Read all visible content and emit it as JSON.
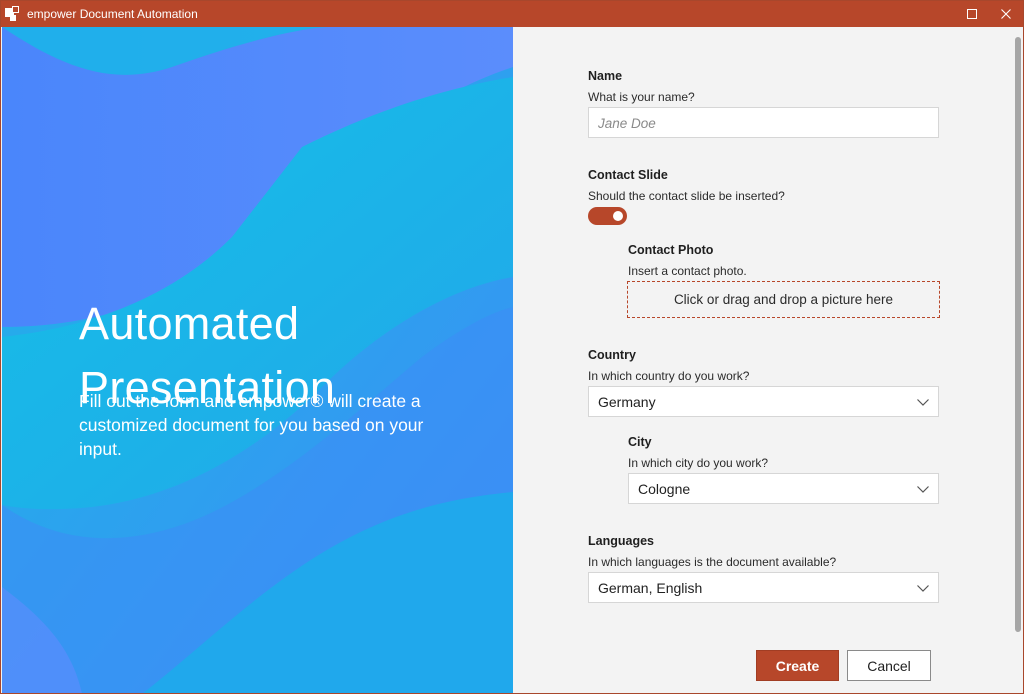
{
  "window": {
    "title": "empower Document Automation",
    "accent_color": "#b7472a"
  },
  "hero": {
    "title_line1": "Automated",
    "title_line2": "Presentation",
    "description": "Fill out the form and empower® will create a customized document for you based on your input."
  },
  "form": {
    "name": {
      "label": "Name",
      "hint": "What is your name?",
      "value": "",
      "placeholder": "Jane Doe"
    },
    "contact_slide": {
      "label": "Contact Slide",
      "hint": "Should the contact slide be inserted?",
      "enabled": true
    },
    "contact_photo": {
      "label": "Contact Photo",
      "hint": "Insert a contact photo.",
      "dropzone_text": "Click or drag and drop a picture here"
    },
    "country": {
      "label": "Country",
      "hint": "In which country do you work?",
      "value": "Germany"
    },
    "city": {
      "label": "City",
      "hint": "In which city do you work?",
      "value": "Cologne"
    },
    "languages": {
      "label": "Languages",
      "hint": "In which languages is the document available?",
      "value": "German, English"
    }
  },
  "buttons": {
    "create": "Create",
    "cancel": "Cancel"
  },
  "icons": {
    "app": "app-logo-icon",
    "maximize": "maximize-icon",
    "close": "close-icon",
    "dropdown": "chevron-down-icon"
  }
}
